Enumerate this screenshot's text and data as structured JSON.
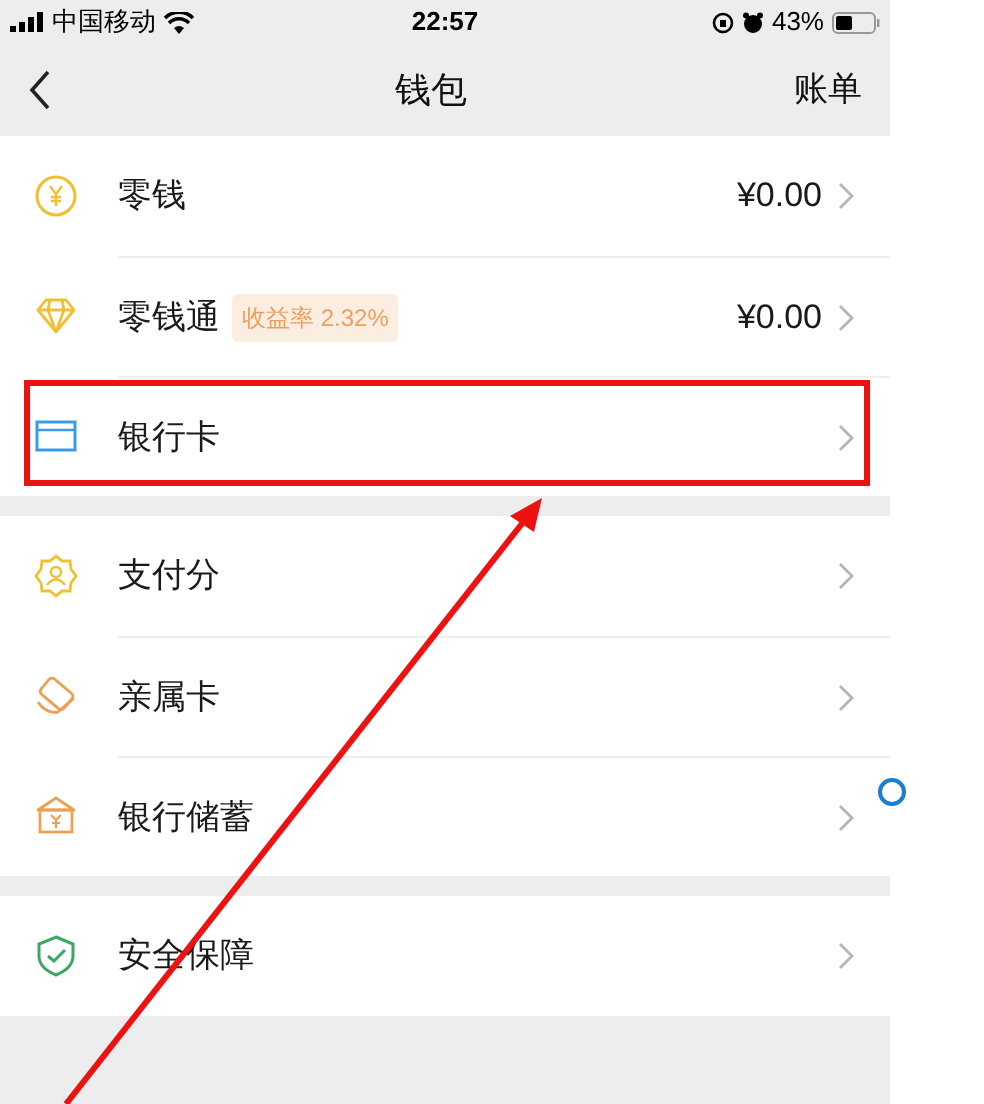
{
  "status_bar": {
    "carrier": "中国移动",
    "time": "22:57",
    "battery": "43%"
  },
  "nav": {
    "title": "钱包",
    "action": "账单"
  },
  "sections": [
    [
      {
        "label": "零钱",
        "value": "¥0.00",
        "highlighted": false
      },
      {
        "label": "零钱通",
        "badge": "收益率 2.32%",
        "value": "¥0.00",
        "highlighted": false
      },
      {
        "label": "银行卡",
        "highlighted": true
      }
    ],
    [
      {
        "label": "支付分",
        "highlighted": false
      },
      {
        "label": "亲属卡",
        "highlighted": false
      },
      {
        "label": "银行储蓄",
        "highlighted": false
      }
    ],
    [
      {
        "label": "安全保障",
        "highlighted": false
      }
    ]
  ]
}
